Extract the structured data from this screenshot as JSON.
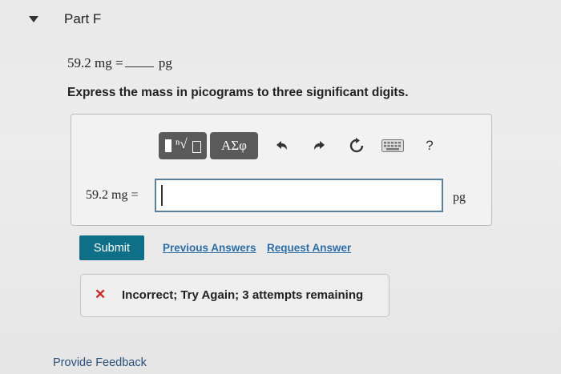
{
  "part": {
    "title": "Part F"
  },
  "problem": {
    "left": "59.2 mg",
    "equals": "=",
    "unit": "pg",
    "instruction": "Express the mass in picograms to three significant digits."
  },
  "toolbar": {
    "templates_icon": "matrix-radical-icon",
    "symbols_label": "ΑΣφ",
    "undo_icon": "undo-icon",
    "redo_icon": "redo-icon",
    "reset_icon": "reset-icon",
    "keyboard_icon": "keyboard-icon",
    "help_label": "?"
  },
  "answer": {
    "label": "59.2 mg =",
    "value": "",
    "unit": "pg"
  },
  "actions": {
    "submit_label": "Submit",
    "previous_answers_label": "Previous Answers",
    "request_answer_label": "Request Answer"
  },
  "feedback": {
    "icon": "✕",
    "message": "Incorrect; Try Again; 3 attempts remaining"
  },
  "footer": {
    "provide_feedback_label": "Provide Feedback"
  },
  "colors": {
    "submit_bg": "#0f6f87",
    "link": "#2c6ea6",
    "error": "#c62828",
    "toolbar_button": "#5a5a5a",
    "input_border": "#5b7f97"
  }
}
